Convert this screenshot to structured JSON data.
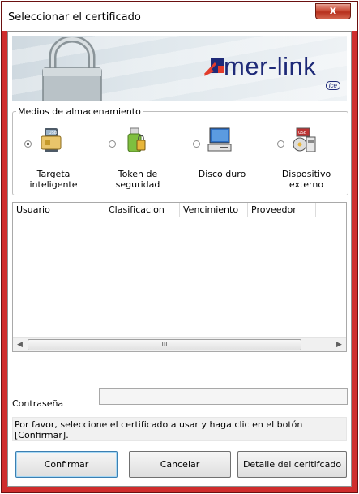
{
  "window": {
    "title": "Seleccionar el certificado",
    "close_symbol": "x"
  },
  "banner": {
    "logo_text": "mer-link",
    "logo_badge": "ice",
    "lock_icon": "padlock-icon"
  },
  "storage": {
    "legend": "Medios de almacenamiento",
    "options": [
      {
        "line1": "Targeta",
        "line2": "inteligente",
        "checked": true,
        "icon": "smart-card-icon"
      },
      {
        "line1": "Token de",
        "line2": "seguridad",
        "checked": false,
        "icon": "security-token-icon"
      },
      {
        "line1": "Disco duro",
        "line2": "",
        "checked": false,
        "icon": "hard-disk-icon"
      },
      {
        "line1": "Dispositivo",
        "line2": "externo",
        "checked": false,
        "icon": "external-device-icon"
      }
    ]
  },
  "table": {
    "columns": [
      "Usuario",
      "Clasificacion",
      "Vencimiento",
      "Proveedor"
    ],
    "rows": [],
    "scroll_thumb_glyph": "III"
  },
  "password": {
    "label": "Contraseña",
    "value": ""
  },
  "message": "Por favor, seleccione el certificado a usar y haga clic en el botón [Confirmar].",
  "buttons": {
    "confirm": "Confirmar",
    "cancel": "Cancelar",
    "detail": "Detalle del ceritifcado"
  },
  "colors": {
    "window_frame": "#cf2d2d",
    "logo_blue": "#1e2a78"
  }
}
